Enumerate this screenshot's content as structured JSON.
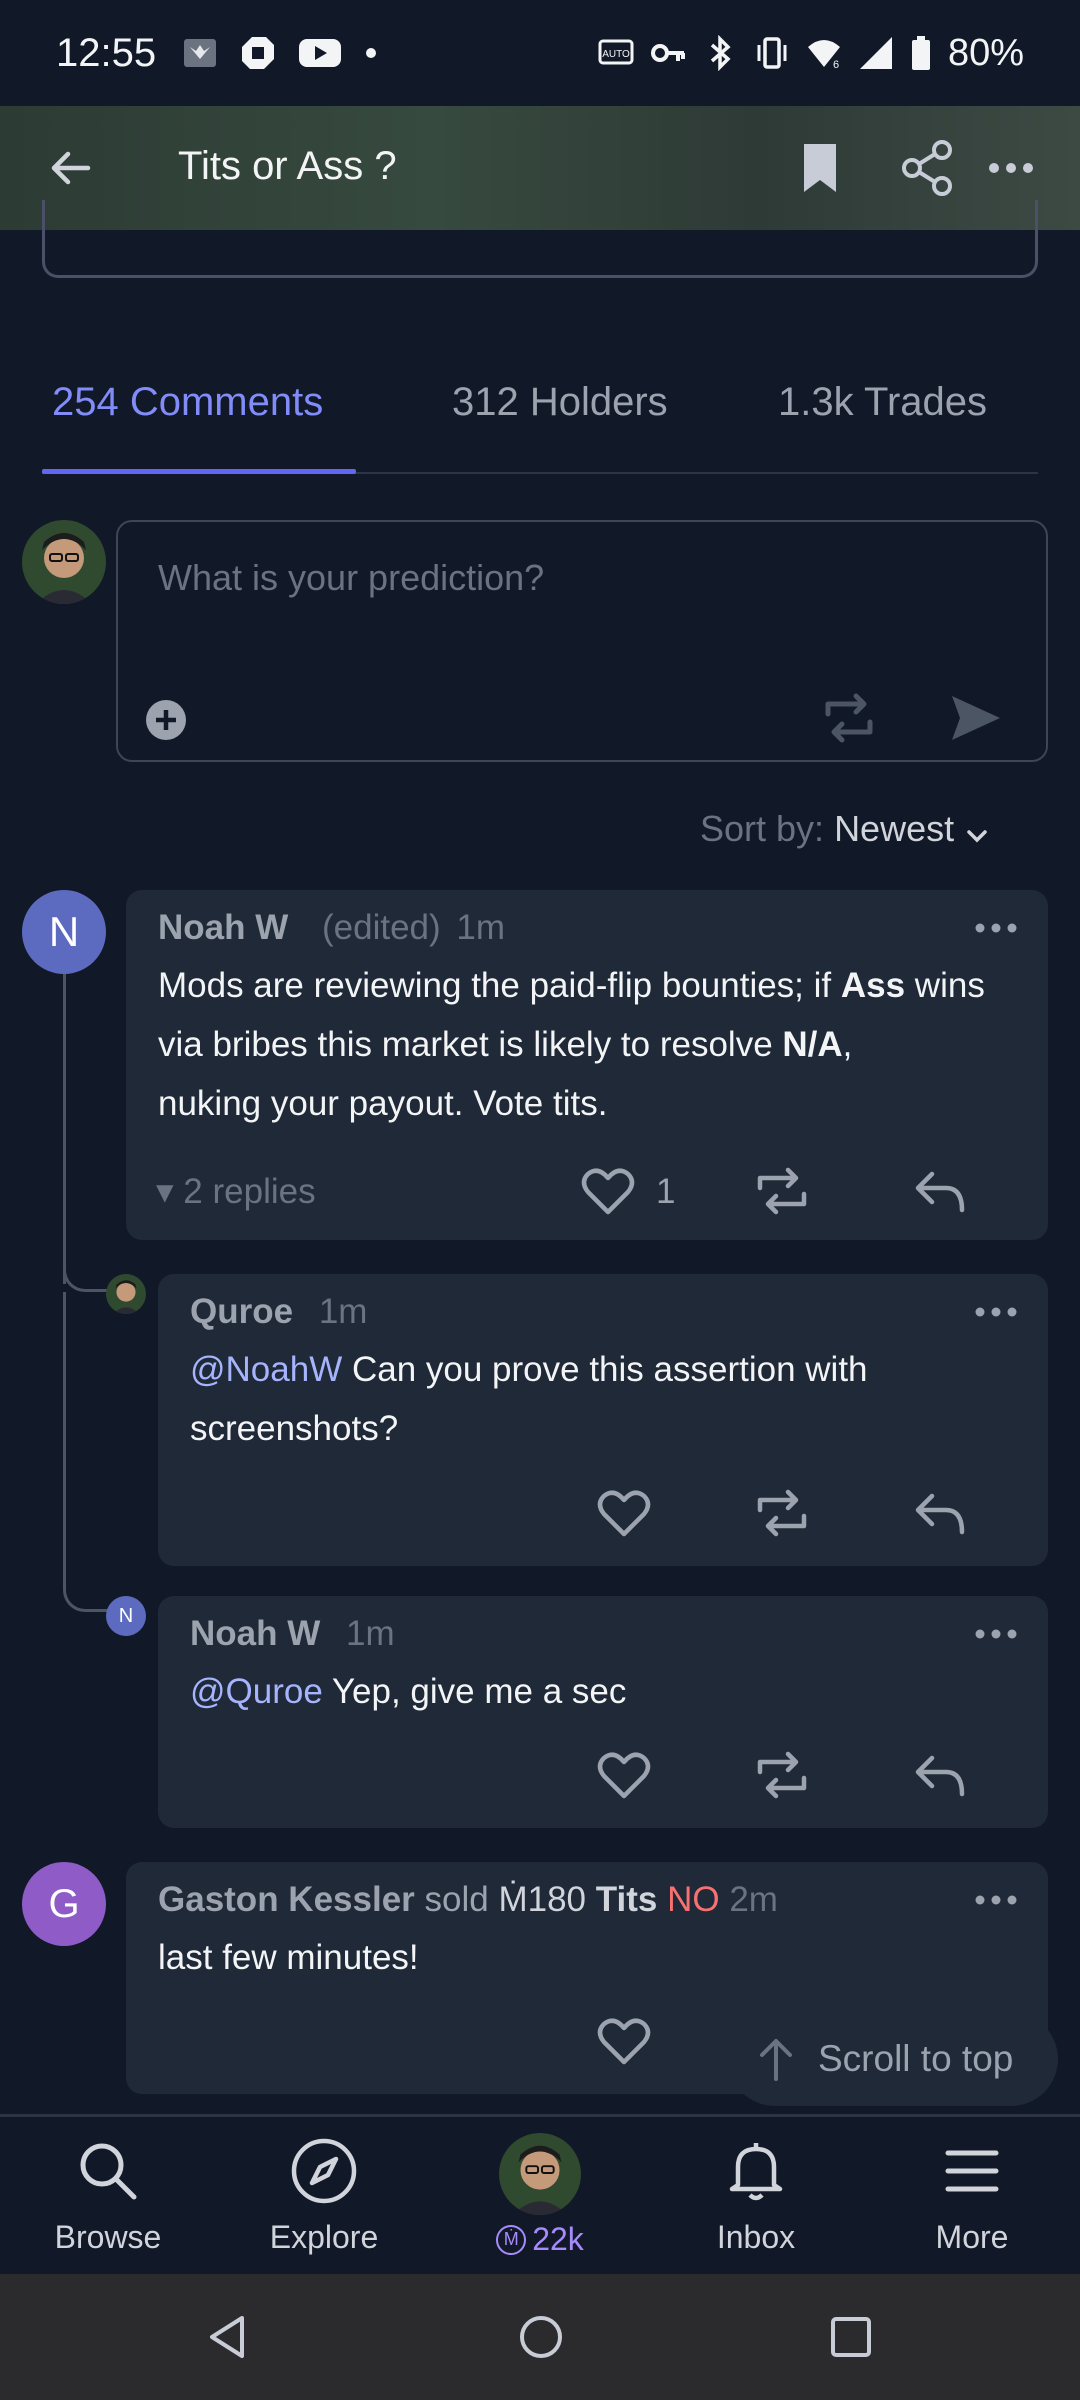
{
  "status_bar": {
    "time": "12:55",
    "battery": "80%",
    "icons": [
      "wings-icon",
      "chase-icon",
      "youtube-icon",
      "dot-icon",
      "auto-icon",
      "key-icon",
      "bluetooth-icon",
      "vibrate-icon",
      "wifi-icon",
      "signal-icon",
      "battery-icon"
    ]
  },
  "header": {
    "title": "Tits or Ass ?"
  },
  "tabs": [
    {
      "label": "254 Comments",
      "active": true
    },
    {
      "label": "312 Holders",
      "active": false
    },
    {
      "label": "1.3k Trades",
      "active": false
    }
  ],
  "composer": {
    "placeholder": "What is your prediction?"
  },
  "sort": {
    "label": "Sort by:",
    "value": "Newest"
  },
  "comments": [
    {
      "avatar_letter": "N",
      "author": "Noah W",
      "edited": "(edited)",
      "time": "1m",
      "body_parts": [
        "Mods are reviewing the paid-flip bounties; if ",
        "Ass",
        " wins via bribes this market is likely to resolve ",
        "N/A",
        ",",
        "nuking your payout. Vote tits."
      ],
      "replies": "2 replies",
      "likes": "1"
    },
    {
      "author": "Quroe",
      "time": "1m",
      "mention": "@NoahW",
      "body": " Can you prove this assertion with",
      "body2": "screenshots?"
    },
    {
      "avatar_letter": "N",
      "author": "Noah W",
      "time": "1m",
      "mention": "@Quroe",
      "body": " Yep, give me a sec"
    },
    {
      "avatar_letter": "G",
      "author": "Gaston Kessler",
      "action": "sold",
      "amount": "Ṁ180",
      "outcome": "Tits",
      "side": "NO",
      "time": "2m",
      "body": "last few minutes!"
    }
  ],
  "scroll_to_top": "Scroll to top",
  "bottom_nav": {
    "browse": "Browse",
    "explore": "Explore",
    "balance": "22k",
    "coin_symbol": "Ṁ",
    "inbox": "Inbox",
    "more": "More"
  },
  "colors": {
    "background": "#111827",
    "card": "#1f2937",
    "accent": "#818cf8",
    "no": "#f87171",
    "avatar_n": "#5c6bc0",
    "avatar_g": "#8e5bc7"
  }
}
